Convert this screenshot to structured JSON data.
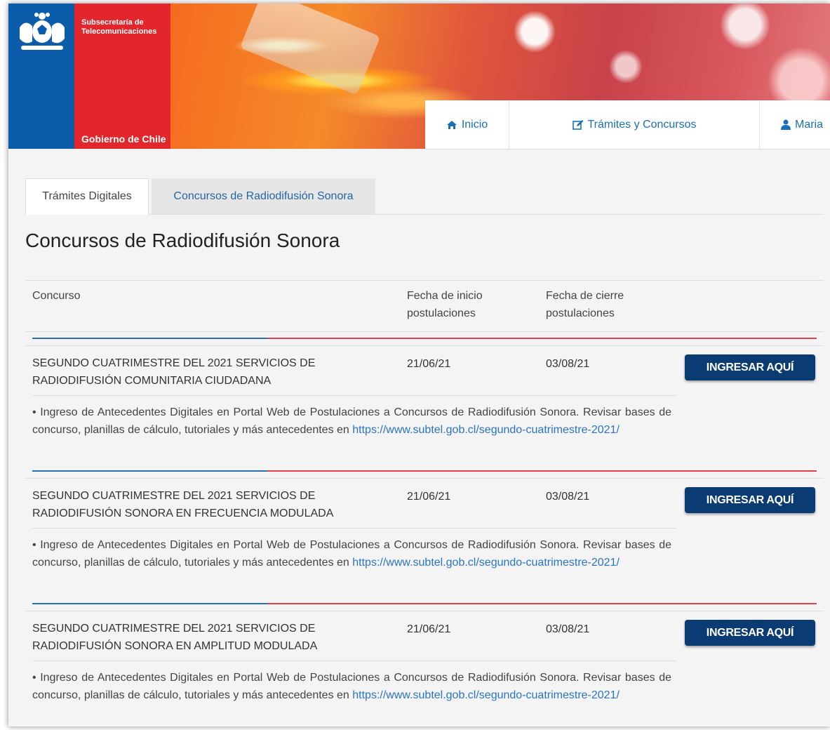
{
  "header": {
    "subsecretaria": "Subsecretaría de Telecomunicaciones",
    "gobierno": "Gobierno de Chile",
    "colors": {
      "blue": "#0b5cab",
      "red": "#e2262c",
      "nav_text": "#1a6fb5"
    }
  },
  "nav": {
    "items": [
      {
        "label": "Inicio",
        "icon": "home-icon"
      },
      {
        "label": "Trámites y Concursos",
        "icon": "edit-icon"
      },
      {
        "label": "Maria",
        "icon": "user-icon"
      }
    ]
  },
  "tabs": [
    {
      "label": "Trámites Digitales",
      "active": true
    },
    {
      "label": "Concursos de Radiodifusión Sonora",
      "active": false
    }
  ],
  "section_title": "Concursos de Radiodifusión Sonora",
  "table": {
    "headers": {
      "concurso": "Concurso",
      "inicio": "Fecha de inicio postulaciones",
      "cierre": "Fecha de cierre postulaciones"
    },
    "rows": [
      {
        "name": "SEGUNDO CUATRIMESTRE DEL 2021 SERVICIOS DE RADIODIFUSIÓN COMUNITARIA CIUDADANA",
        "inicio": "21/06/21",
        "cierre": "03/08/21",
        "button": "INGRESAR AQUÍ",
        "desc": "• Ingreso de Antecedentes Digitales en Portal Web de Postulaciones a Concursos de Radiodifusión Sonora. Revisar bases de concurso, planillas de cálculo, tutoriales y más antecedentes en ",
        "link": "https://www.subtel.gob.cl/segundo-cuatrimestre-2021/"
      },
      {
        "name": "SEGUNDO CUATRIMESTRE DEL 2021 SERVICIOS DE RADIODIFUSIÓN SONORA EN FRECUENCIA MODULADA",
        "inicio": "21/06/21",
        "cierre": "03/08/21",
        "button": "INGRESAR AQUÍ",
        "desc": "• Ingreso de Antecedentes Digitales en Portal Web de Postulaciones a Concursos de Radiodifusión Sonora. Revisar bases de concurso, planillas de cálculo, tutoriales y más antecedentes en ",
        "link": "https://www.subtel.gob.cl/segundo-cuatrimestre-2021/"
      },
      {
        "name": "SEGUNDO CUATRIMESTRE DEL 2021 SERVICIOS DE RADIODIFUSIÓN SONORA EN AMPLITUD MODULADA",
        "inicio": "21/06/21",
        "cierre": "03/08/21",
        "button": "INGRESAR AQUÍ",
        "desc": "• Ingreso de Antecedentes Digitales en Portal Web de Postulaciones a Concursos de Radiodifusión Sonora. Revisar bases de concurso, planillas de cálculo, tutoriales y más antecedentes en ",
        "link": "https://www.subtel.gob.cl/segundo-cuatrimestre-2021/"
      }
    ]
  }
}
